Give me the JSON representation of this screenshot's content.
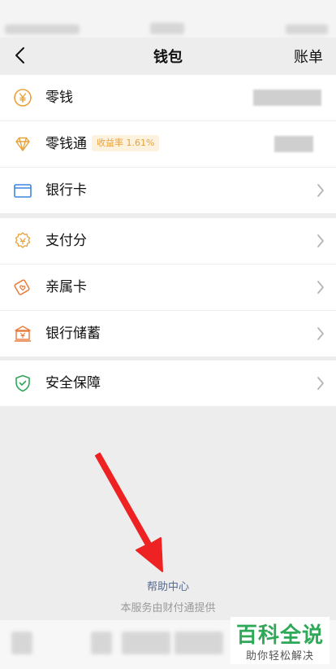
{
  "nav": {
    "title": "钱包",
    "right_label": "账单"
  },
  "group1": [
    {
      "label": "零钱",
      "icon": "yen-coin-icon"
    },
    {
      "label": "零钱通",
      "icon": "diamond-icon",
      "badge": "收益率 1.61%"
    },
    {
      "label": "银行卡",
      "icon": "bank-card-icon"
    }
  ],
  "group2": [
    {
      "label": "支付分",
      "icon": "pay-score-icon"
    },
    {
      "label": "亲属卡",
      "icon": "family-card-icon"
    },
    {
      "label": "银行储蓄",
      "icon": "bank-savings-icon"
    }
  ],
  "group3": [
    {
      "label": "安全保障",
      "icon": "shield-check-icon"
    }
  ],
  "footer": {
    "help": "帮助中心",
    "provider": "本服务由财付通提供"
  },
  "watermark": {
    "top": "百科全说",
    "bottom": "助你轻松解决"
  },
  "colors": {
    "accent_gold": "#e9a13b",
    "accent_blue": "#3b86e0",
    "accent_green": "#2fa857",
    "arrow_red": "#ee2222",
    "link": "#576b95"
  }
}
